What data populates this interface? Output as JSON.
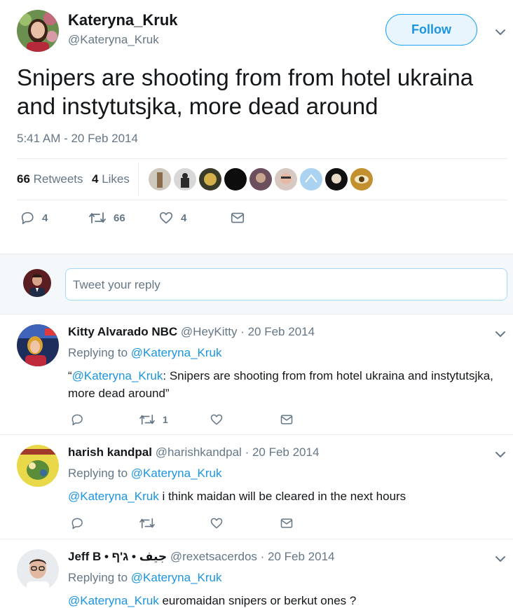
{
  "main_tweet": {
    "display_name": "Kateryna_Kruk",
    "handle": "@Kateryna_Kruk",
    "follow_label": "Follow",
    "text": "Snipers are shooting from from hotel ukraina and instytutsjka, more dead around",
    "timestamp": "5:41 AM - 20 Feb 2014",
    "retweets_count": "66",
    "retweets_label": "Retweets",
    "likes_count": "4",
    "likes_label": "Likes",
    "actions": {
      "replies": "4",
      "retweets": "66",
      "likes": "4"
    }
  },
  "reply_box": {
    "placeholder": "Tweet your reply"
  },
  "replies": [
    {
      "name": "Kitty Alvarado NBC",
      "handle": "@HeyKitty",
      "date": "· 20 Feb 2014",
      "replying_prefix": "Replying to",
      "replying_handle": "@Kateryna_Kruk",
      "text_open": "“",
      "mention": "@Kateryna_Kruk",
      "text": ": Snipers are shooting from from hotel ukraina and instytutsjka, more dead around”",
      "retweets": "1"
    },
    {
      "name": "harish kandpal",
      "handle": "@harishkandpal",
      "date": "· 20 Feb 2014",
      "replying_prefix": "Replying to",
      "replying_handle": "@Kateryna_Kruk",
      "mention": "@Kateryna_Kruk",
      "text": " i think maidan will be cleared in the next hours"
    },
    {
      "name": "Jeff B • جيف • ג'ף",
      "handle": "@rexetsacerdos",
      "date": "· 20 Feb 2014",
      "replying_prefix": "Replying to",
      "replying_handle": "@Kateryna_Kruk",
      "mention": "@Kateryna_Kruk",
      "text": " euromaidan snipers or berkut ones ?"
    }
  ],
  "colors": {
    "accent": "#1da1f2",
    "link": "#1b95e0",
    "muted": "#657786",
    "text": "#14171a"
  }
}
